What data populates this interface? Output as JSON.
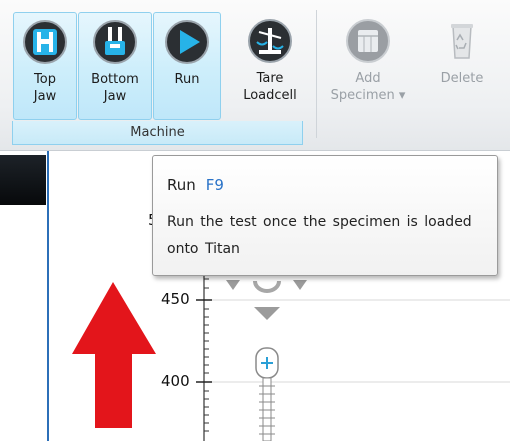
{
  "ribbon": {
    "buttons": [
      {
        "name": "top-jaw-button",
        "icon": "top-jaw-icon",
        "label": "Top\nJaw",
        "state": "active"
      },
      {
        "name": "bottom-jaw-button",
        "icon": "bottom-jaw-icon",
        "label": "Bottom\nJaw",
        "state": "active"
      },
      {
        "name": "run-button",
        "icon": "play-icon",
        "label": "Run",
        "state": "active"
      },
      {
        "name": "tare-loadcell-button",
        "icon": "tare-loadcell-icon",
        "label": "Tare\nLoadcell",
        "state": "normal"
      },
      {
        "name": "add-specimen-button",
        "icon": "add-specimen-icon",
        "label": "Add\nSpecimen ▾",
        "state": "disabled"
      },
      {
        "name": "delete-button",
        "icon": "recycle-bin-icon",
        "label": "Delete",
        "state": "disabled"
      }
    ],
    "group_label": "Machine"
  },
  "tooltip": {
    "title": "Run",
    "shortcut": "F9",
    "body": "Run the test once the specimen is loaded onto Titan"
  },
  "gauge": {
    "ticks": [
      "450",
      "400"
    ],
    "partial_tick": "5"
  },
  "colors": {
    "accent_blue": "#2a73c8",
    "arrow_red": "#e3151b",
    "active_button_bg": "#cdeefb"
  }
}
